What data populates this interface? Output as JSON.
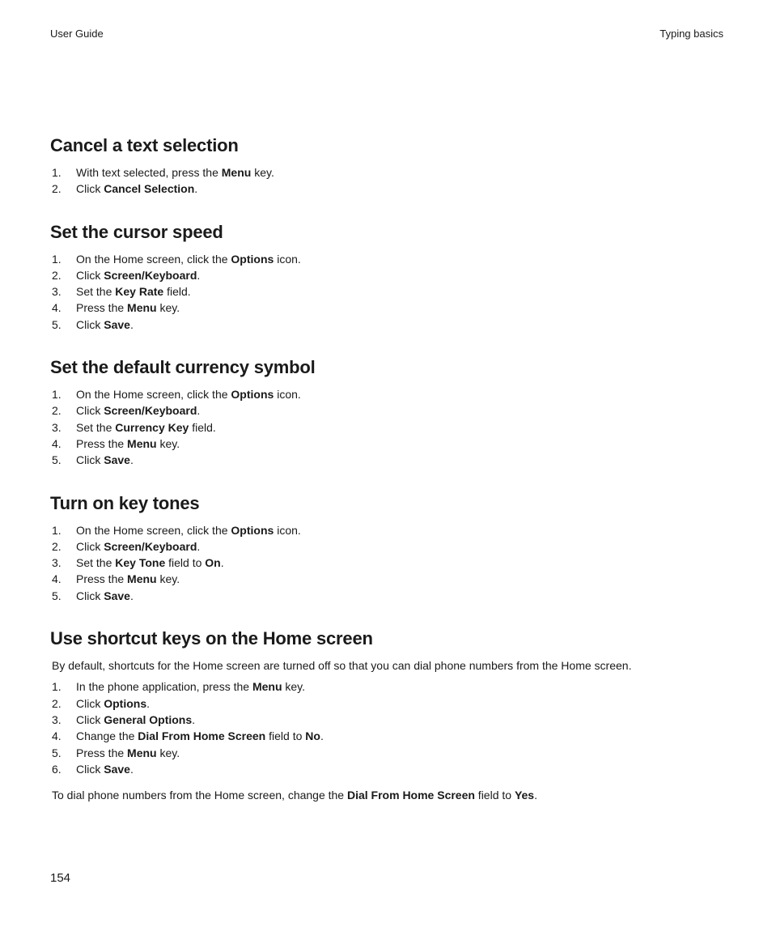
{
  "header": {
    "left": "User Guide",
    "right": "Typing basics"
  },
  "pageNumber": "154",
  "sections": [
    {
      "heading": "Cancel a text selection",
      "steps": [
        {
          "pre": "With text selected, press the ",
          "bold": "Menu",
          "post": " key."
        },
        {
          "pre": "Click ",
          "bold": "Cancel Selection",
          "post": "."
        }
      ]
    },
    {
      "heading": "Set the cursor speed",
      "steps": [
        {
          "pre": "On the Home screen, click the ",
          "bold": "Options",
          "post": " icon."
        },
        {
          "pre": "Click ",
          "bold": "Screen/Keyboard",
          "post": "."
        },
        {
          "pre": "Set the ",
          "bold": "Key Rate",
          "post": " field."
        },
        {
          "pre": "Press the ",
          "bold": "Menu",
          "post": " key."
        },
        {
          "pre": "Click ",
          "bold": "Save",
          "post": "."
        }
      ]
    },
    {
      "heading": "Set the default currency symbol",
      "steps": [
        {
          "pre": "On the Home screen, click the ",
          "bold": "Options",
          "post": " icon."
        },
        {
          "pre": "Click ",
          "bold": "Screen/Keyboard",
          "post": "."
        },
        {
          "pre": "Set the ",
          "bold": "Currency Key",
          "post": " field."
        },
        {
          "pre": "Press the ",
          "bold": "Menu",
          "post": " key."
        },
        {
          "pre": "Click ",
          "bold": "Save",
          "post": "."
        }
      ]
    },
    {
      "heading": "Turn on key tones",
      "steps": [
        {
          "pre": "On the Home screen, click the ",
          "bold": "Options",
          "post": " icon."
        },
        {
          "pre": "Click ",
          "bold": "Screen/Keyboard",
          "post": "."
        },
        {
          "pre": "Set the ",
          "bold": "Key Tone",
          "post": " field to ",
          "bold2": "On",
          "post2": "."
        },
        {
          "pre": "Press the ",
          "bold": "Menu",
          "post": " key."
        },
        {
          "pre": "Click ",
          "bold": "Save",
          "post": "."
        }
      ]
    },
    {
      "heading": "Use shortcut keys on the Home screen",
      "intro": "By default, shortcuts for the Home screen are turned off so that you can dial phone numbers from the Home screen.",
      "steps": [
        {
          "pre": "In the phone application, press the ",
          "bold": "Menu",
          "post": " key."
        },
        {
          "pre": "Click ",
          "bold": "Options",
          "post": "."
        },
        {
          "pre": "Click ",
          "bold": "General Options",
          "post": "."
        },
        {
          "pre": "Change the ",
          "bold": "Dial From Home Screen",
          "post": " field to ",
          "bold2": "No",
          "post2": "."
        },
        {
          "pre": "Press the ",
          "bold": "Menu",
          "post": " key."
        },
        {
          "pre": "Click ",
          "bold": "Save",
          "post": "."
        }
      ],
      "outro_pre": "To dial phone numbers from the Home screen, change the ",
      "outro_bold": "Dial From Home Screen",
      "outro_mid": " field to ",
      "outro_bold2": "Yes",
      "outro_post": "."
    }
  ]
}
